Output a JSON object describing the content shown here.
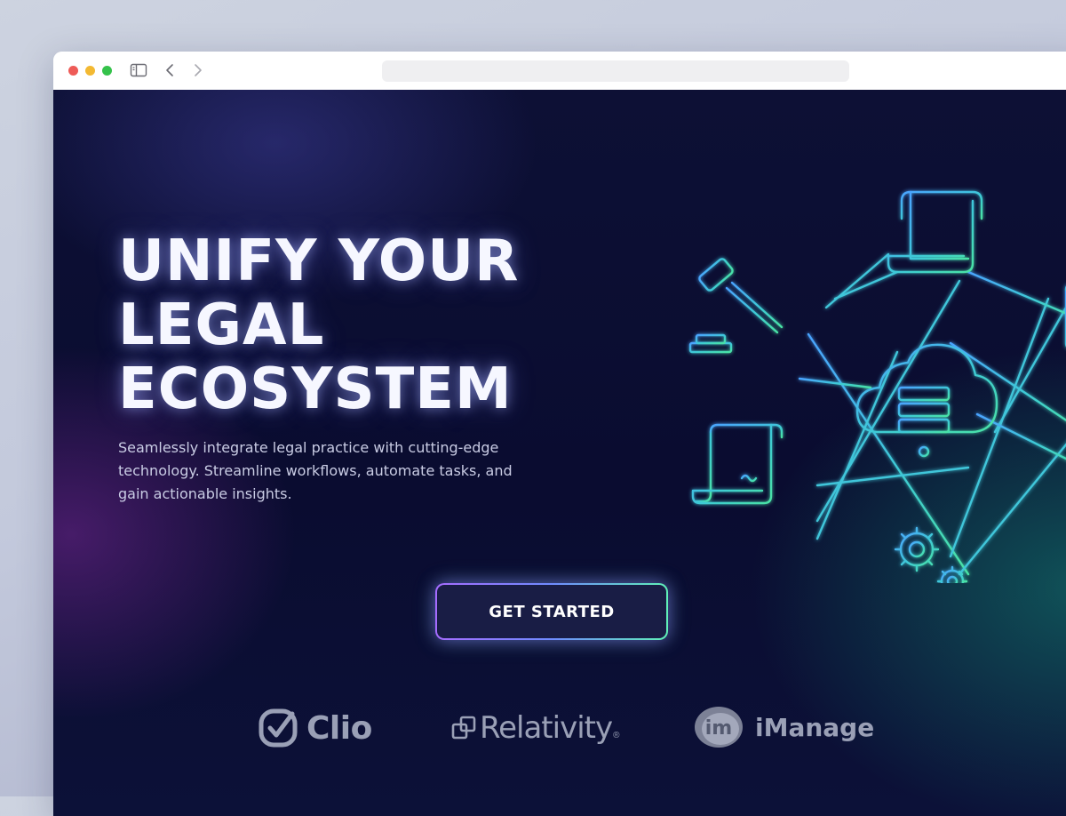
{
  "browser": {
    "icons": [
      "close-dot",
      "minimize-dot",
      "zoom-dot",
      "sidebar-icon",
      "back-icon",
      "forward-icon"
    ],
    "url": ""
  },
  "hero": {
    "headline_lines": [
      "UNIFY YOUR",
      "LEGAL",
      "ECOSYSTEM"
    ],
    "subtext": "Seamlessly integrate legal practice with cutting-edge technology. Streamline workflows, automate tasks, and gain actionable insights.",
    "cta_label": "GET STARTED",
    "illustration_icons": [
      "gavel-icon",
      "scroll-document-icon",
      "contract-icon",
      "cloud-server-icon",
      "gears-icon",
      "database-icon"
    ]
  },
  "partners": [
    {
      "name": "Clio",
      "icon": "checkmark-badge"
    },
    {
      "name": "Relativity",
      "icon": "overlapping-squares",
      "mark": "®"
    },
    {
      "name": "iManage",
      "icon": "im-circle",
      "icon_text": "im"
    }
  ],
  "colors": {
    "background": "#0b0d33",
    "headline": "#f6f7ff",
    "subtext": "#c9cce4",
    "cta_gradient_start": "#a56cff",
    "cta_gradient_end": "#5ff0b8",
    "network_blue": "#4aa3ff",
    "network_green": "#49e3a4",
    "logo_gray": "#9aa0b6"
  }
}
